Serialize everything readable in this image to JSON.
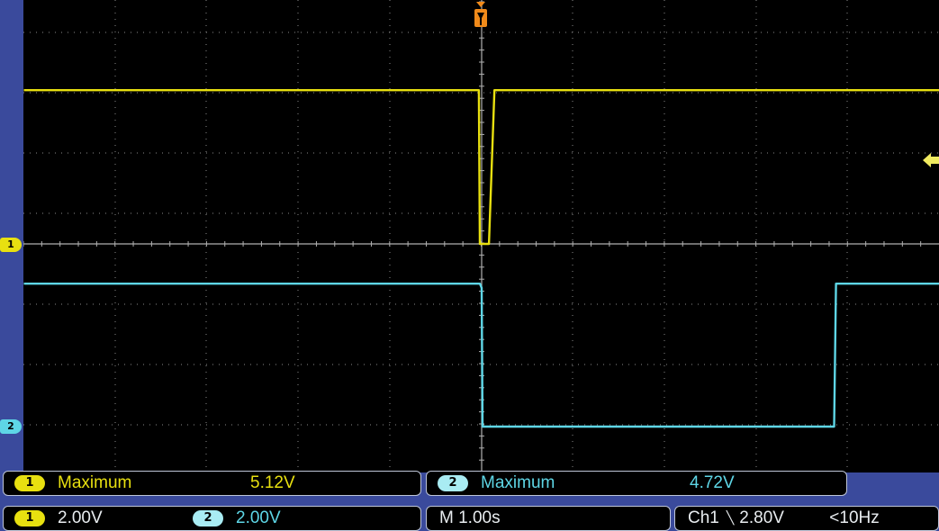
{
  "scope": {
    "channel_markers": {
      "ch1": "1",
      "ch2": "2"
    },
    "colors": {
      "ch1": "#e8e010",
      "ch2": "#5ed6e6",
      "grid": "#8a8a8a",
      "screen_bg": "#000000",
      "frame": "#3a4a9c"
    },
    "icons": {
      "trigger_position": "trigger-position-icon",
      "trigger_level": "trigger-level-arrow-icon"
    }
  },
  "chart_data": {
    "type": "line",
    "grid": true,
    "divisions": {
      "horizontal": 10,
      "vertical": 8
    },
    "series": [
      {
        "name": "1",
        "comment_units": "divisions relative to channel 1 ground reference",
        "x": [
          -5.0,
          -0.03,
          -0.02,
          0.08,
          0.14,
          5.0
        ],
        "values": [
          2.55,
          2.55,
          0.0,
          0.0,
          2.55,
          2.55
        ]
      },
      {
        "name": "2",
        "x": [
          -5.0,
          -0.02,
          0.0,
          0.01,
          3.85,
          3.87,
          5.0
        ],
        "values": [
          2.37,
          2.37,
          2.3,
          0.0,
          0.0,
          2.37,
          2.37
        ]
      }
    ]
  },
  "measurements": {
    "ch1": {
      "badge": "1",
      "label": "Maximum",
      "value": "5.12V"
    },
    "ch2": {
      "badge": "2",
      "label": "Maximum",
      "value": "4.72V"
    }
  },
  "vertical": {
    "ch1": {
      "badge": "1",
      "scale": "2.00V"
    },
    "ch2": {
      "badge": "2",
      "scale": "2.00V"
    }
  },
  "timebase": {
    "text": "M 1.00s"
  },
  "trigger": {
    "source": "Ch1",
    "slope_symbol": "╲",
    "level": "2.80V",
    "freq": "<10Hz"
  }
}
